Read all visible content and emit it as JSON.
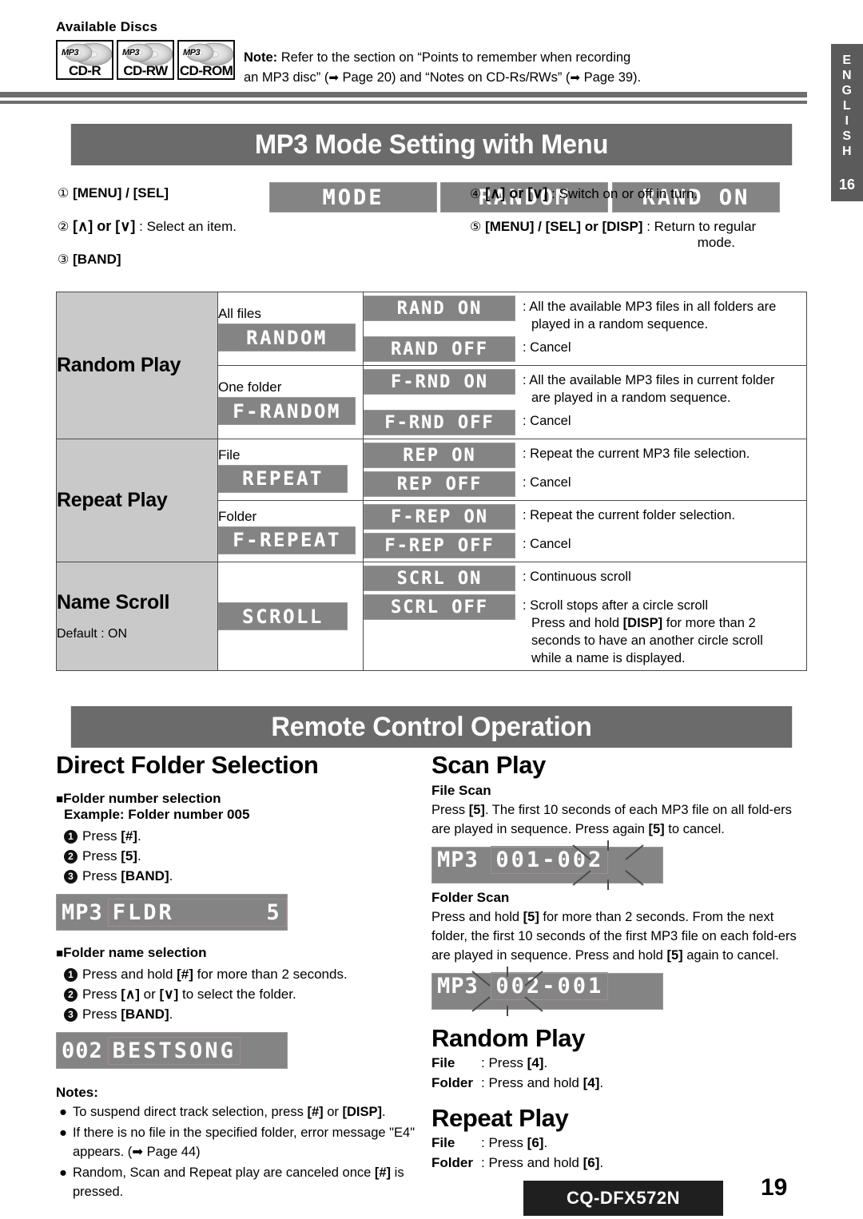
{
  "available_discs": {
    "title": "Available Discs",
    "discs": [
      {
        "mp3_badge": "MP3",
        "label": "CD-R"
      },
      {
        "mp3_badge": "MP3",
        "label": "CD-RW"
      },
      {
        "mp3_badge": "MP3",
        "label": "CD-ROM"
      }
    ]
  },
  "note_top": {
    "bold": "Note:",
    "line1": " Refer to the section on “Points to remember when recording",
    "line2_a": "an MP3 disc” (",
    "arrow1": "➡",
    "line2_b": " Page 20) and “Notes on CD-Rs/RWs” (",
    "arrow2": "➡",
    "line2_c": " Page 39)."
  },
  "side_tab": {
    "letters": [
      "E",
      "N",
      "G",
      "L",
      "I",
      "S",
      "H"
    ],
    "number": "16"
  },
  "banners": {
    "mp3_mode": "MP3 Mode Setting with Menu",
    "remote": "Remote Control Operation"
  },
  "menu_steps": {
    "left": [
      {
        "circle": "①",
        "text": "[MENU] / [SEL]",
        "suffix": ""
      },
      {
        "circle": "②",
        "text": "[∧] or [∨]",
        "suffix": " : Select an item."
      },
      {
        "circle": "③",
        "text": "[BAND]",
        "suffix": ""
      }
    ],
    "displays": [
      "MODE",
      "RANDOM",
      "RAND ON"
    ],
    "right": [
      {
        "circle": "④",
        "text": "[∧] or [∨]",
        "suffix": " : Switch on or off in turn.",
        "indent": ""
      },
      {
        "circle": "⑤",
        "text": "[MENU] / [SEL] or [DISP]",
        "suffix": " : Return to regular",
        "indent": "mode."
      }
    ]
  },
  "modes_table": {
    "rows": [
      {
        "feature": "Random Play",
        "feature_sub": "",
        "subrows": [
          {
            "name_label": "All files",
            "name_lcd": "RANDOM",
            "values": [
              {
                "lcd": "RAND ON",
                "lcd_width": 190,
                "desc": ": All the available MP3 files in all folders are",
                "desc_indent": "played in a random sequence."
              },
              {
                "lcd": "RAND OFF",
                "lcd_width": 190,
                "desc": ": Cancel",
                "desc_indent": ""
              }
            ]
          },
          {
            "name_label": "One folder",
            "name_lcd": "F-RANDOM",
            "values": [
              {
                "lcd": "F-RND ON",
                "lcd_width": 190,
                "desc": ": All the available MP3 files in current folder",
                "desc_indent": "are played in a random sequence."
              },
              {
                "lcd": "F-RND OFF",
                "lcd_width": 190,
                "desc": ": Cancel",
                "desc_indent": ""
              }
            ]
          }
        ]
      },
      {
        "feature": "Repeat Play",
        "feature_sub": "",
        "subrows": [
          {
            "name_label": "File",
            "name_lcd": "REPEAT",
            "values": [
              {
                "lcd": "REP ON",
                "lcd_width": 190,
                "desc": ": Repeat the current MP3 file selection.",
                "desc_indent": ""
              },
              {
                "lcd": "REP OFF",
                "lcd_width": 190,
                "desc": ": Cancel",
                "desc_indent": ""
              }
            ]
          },
          {
            "name_label": "Folder",
            "name_lcd": "F-REPEAT",
            "values": [
              {
                "lcd": "F-REP ON",
                "lcd_width": 190,
                "desc": ": Repeat the current folder selection.",
                "desc_indent": ""
              },
              {
                "lcd": "F-REP OFF",
                "lcd_width": 190,
                "desc": ": Cancel",
                "desc_indent": ""
              }
            ]
          }
        ]
      },
      {
        "feature": "Name Scroll",
        "feature_sub": "Default : ON",
        "subrows": [
          {
            "name_label": "",
            "name_lcd": "SCROLL",
            "values": [
              {
                "lcd": "SCRL ON",
                "lcd_width": 190,
                "desc": ": Continuous scroll",
                "desc_indent": ""
              },
              {
                "lcd": "SCRL OFF",
                "lcd_width": 190,
                "desc": ": Scroll stops after a circle scroll",
                "desc_indent": "Press and hold [DISP] for more than 2|seconds to have an another circle scroll|while a name is displayed."
              }
            ]
          }
        ]
      }
    ]
  },
  "direct_folder": {
    "heading": "Direct Folder Selection",
    "number_selection_head": "Folder number selection",
    "number_selection_example": "Example: Folder number 005",
    "number_steps": [
      {
        "n": "1",
        "text": "Press [#]."
      },
      {
        "n": "2",
        "text": "Press [5]."
      },
      {
        "n": "3",
        "text": "Press [BAND]."
      }
    ],
    "lcd_number": {
      "prefix": "MP3",
      "body": "FLDR      5"
    },
    "name_selection_head": "Folder name selection",
    "name_steps": [
      {
        "n": "1",
        "text": "Press and hold [#] for more than 2 seconds."
      },
      {
        "n": "2",
        "text": "Press [∧] or [∨] to select the folder."
      },
      {
        "n": "3",
        "text": "Press [BAND]."
      }
    ],
    "lcd_name": {
      "prefix": "002",
      "body": "BESTSONG"
    },
    "notes_heading": "Notes:",
    "notes": [
      "To suspend direct track selection, press [#] or [DISP].",
      "If there is no file in the specified folder, error message \"E4\" appears. (➡ Page 44)",
      "Random, Scan and Repeat play are canceled once [#] is pressed."
    ]
  },
  "scan_play": {
    "heading": "Scan Play",
    "file_scan_head": "File Scan",
    "file_scan_text": "Press [5]. The first 10 seconds of each MP3 file on all fold-ers are played in sequence.  Press again [5] to cancel.",
    "file_scan_lcd": {
      "prefix": "MP3",
      "body": "001-002",
      "flash": "002"
    },
    "folder_scan_head": "Folder Scan",
    "folder_scan_text": "Press and hold [5] for more than 2 seconds.  From the next folder, the first 10 seconds of the first MP3 file on each fold-ers are played in sequence. Press and hold [5] again to cancel.",
    "folder_scan_lcd": {
      "prefix": "MP3",
      "body": "002-001",
      "flash": "002"
    }
  },
  "random_play_remote": {
    "heading": "Random Play",
    "rows": [
      {
        "key": "File",
        "sep": ":",
        "text": "Press [4]."
      },
      {
        "key": "Folder",
        "sep": ":",
        "text": "Press and hold [4]."
      }
    ]
  },
  "repeat_play_remote": {
    "heading": "Repeat Play",
    "rows": [
      {
        "key": "File",
        "sep": ":",
        "text": "Press [6]."
      },
      {
        "key": "Folder",
        "sep": ":",
        "text": "Press and hold [6]."
      }
    ]
  },
  "footer": {
    "model": "CQ-DFX572N",
    "page": "19"
  },
  "colors": {
    "banner_bg": "#6b6b6b",
    "lcd_bg": "#848484",
    "feature_bg": "#c9c9c9",
    "side_tab_bg": "#5b5b5b",
    "badge_bg": "#201f1f"
  }
}
